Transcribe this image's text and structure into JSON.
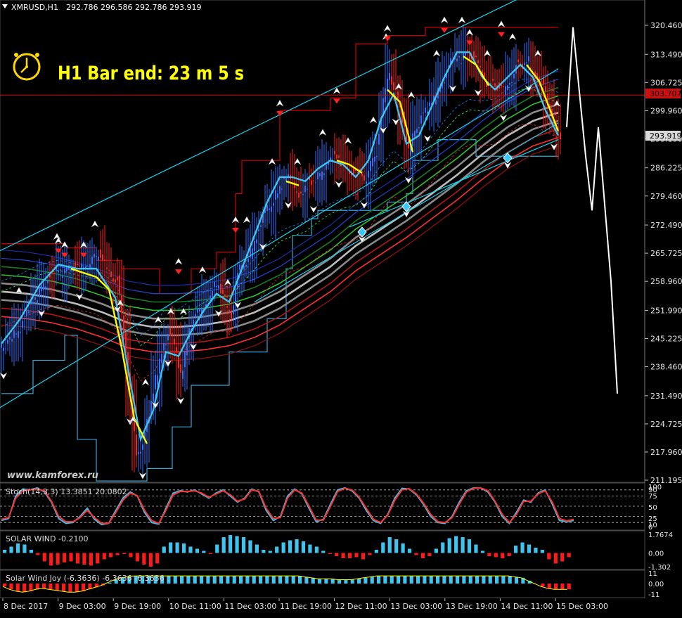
{
  "window": {
    "symbol_title": "XMRUSD,H1",
    "ohlc": "292.786 296.586 292.786 293.919"
  },
  "timer": {
    "text": "H1 Bar end: 23 m 5 s",
    "icon": "alarm-clock-icon",
    "color": "#ffff00"
  },
  "watermark": "www.kamforex.ru",
  "colors": {
    "bull": "#2a72ff",
    "bear": "#ff2020",
    "cyan": "#3fc3ef",
    "yellow": "#ffff00",
    "channel": "#17d4f0",
    "donchian_hi": "#d00000",
    "hline": "#d01010",
    "stoch_main": "#3fc3ef",
    "stoch_signal": "#ff3030",
    "forecast": "#ffffff"
  },
  "chart_data": [
    {
      "type": "line",
      "name": "main",
      "title": "XMRUSD,H1",
      "y_axis_ticks": [
        "320.460",
        "313.490",
        "306.725",
        "299.960",
        "293.190",
        "286.225",
        "279.460",
        "272.490",
        "265.725",
        "258.960",
        "251.990",
        "245.225",
        "238.460",
        "231.490",
        "224.725",
        "217.960",
        "211.195"
      ],
      "ylim": [
        211.195,
        320.46
      ],
      "x_axis_ticks": [
        "8 Dec 2017",
        "9 Dec 03:00",
        "9 Dec 19:00",
        "10 Dec 11:00",
        "11 Dec 03:00",
        "11 Dec 19:00",
        "12 Dec 11:00",
        "13 Dec 03:00",
        "13 Dec 19:00",
        "14 Dec 11:00",
        "15 Dec 03:00"
      ],
      "current_price": "293.919",
      "hline_price": "303.707",
      "close_path": [
        [
          0,
          243
        ],
        [
          3,
          249
        ],
        [
          6,
          258
        ],
        [
          9,
          262
        ],
        [
          12,
          262
        ],
        [
          15,
          265
        ],
        [
          18,
          259
        ],
        [
          19,
          246
        ],
        [
          20,
          232
        ],
        [
          21,
          218
        ],
        [
          22,
          219
        ],
        [
          23,
          227
        ],
        [
          24,
          236
        ],
        [
          25,
          242
        ],
        [
          26,
          246
        ],
        [
          27,
          244
        ],
        [
          28,
          237
        ],
        [
          29,
          244
        ],
        [
          30,
          250
        ],
        [
          32,
          254
        ],
        [
          34,
          258
        ],
        [
          36,
          251
        ],
        [
          37,
          260
        ],
        [
          39,
          266
        ],
        [
          41,
          274
        ],
        [
          43,
          280
        ],
        [
          45,
          284
        ],
        [
          47,
          280
        ],
        [
          49,
          283
        ],
        [
          51,
          287
        ],
        [
          53,
          289
        ],
        [
          55,
          285
        ],
        [
          57,
          284
        ],
        [
          59,
          290
        ],
        [
          60,
          302
        ],
        [
          61,
          310
        ],
        [
          62,
          304
        ],
        [
          63,
          298
        ],
        [
          64,
          290
        ],
        [
          65,
          296
        ],
        [
          67,
          300
        ],
        [
          69,
          306
        ],
        [
          71,
          312
        ],
        [
          73,
          314
        ],
        [
          75,
          311
        ],
        [
          77,
          306
        ],
        [
          79,
          305
        ],
        [
          81,
          310
        ],
        [
          83,
          312
        ],
        [
          85,
          306
        ],
        [
          87,
          298
        ],
        [
          88,
          293.9
        ]
      ],
      "cyan_ma": [
        [
          0,
          244
        ],
        [
          3,
          250
        ],
        [
          6,
          258
        ],
        [
          9,
          263
        ],
        [
          12,
          262
        ],
        [
          15,
          262
        ],
        [
          18,
          255
        ],
        [
          20,
          238
        ],
        [
          22,
          221
        ],
        [
          24,
          228
        ],
        [
          26,
          242
        ],
        [
          28,
          241
        ],
        [
          30,
          247
        ],
        [
          32,
          252
        ],
        [
          34,
          256
        ],
        [
          36,
          254
        ],
        [
          38,
          262
        ],
        [
          40,
          270
        ],
        [
          42,
          278
        ],
        [
          44,
          284
        ],
        [
          46,
          284
        ],
        [
          48,
          283
        ],
        [
          50,
          286
        ],
        [
          52,
          288
        ],
        [
          54,
          287
        ],
        [
          56,
          284
        ],
        [
          58,
          288
        ],
        [
          60,
          298
        ],
        [
          62,
          304
        ],
        [
          64,
          292
        ],
        [
          66,
          294
        ],
        [
          68,
          301
        ],
        [
          70,
          308
        ],
        [
          72,
          314
        ],
        [
          74,
          314
        ],
        [
          76,
          308
        ],
        [
          78,
          305
        ],
        [
          80,
          308
        ],
        [
          82,
          311
        ],
        [
          84,
          308
        ],
        [
          86,
          300
        ],
        [
          88,
          294
        ]
      ],
      "yellow_ma": [
        [
          11,
          262
        ],
        [
          13,
          261
        ],
        [
          15,
          260
        ],
        [
          17,
          257
        ],
        [
          19,
          243
        ],
        [
          21,
          226
        ],
        [
          23,
          220
        ],
        [
          25,
          226
        ],
        [
          27,
          238
        ],
        [
          29,
          245
        ],
        [
          31,
          249
        ],
        [
          33,
          253
        ],
        [
          35,
          256
        ],
        [
          37,
          259
        ],
        [
          39,
          264
        ],
        [
          41,
          271
        ],
        [
          43,
          278
        ],
        [
          45,
          283
        ],
        [
          47,
          282
        ],
        [
          49,
          283
        ],
        [
          51,
          286
        ],
        [
          53,
          288
        ],
        [
          55,
          287
        ],
        [
          57,
          285
        ],
        [
          59,
          292
        ],
        [
          61,
          305
        ],
        [
          63,
          302
        ],
        [
          65,
          290
        ],
        [
          67,
          298
        ],
        [
          69,
          304
        ],
        [
          71,
          310
        ],
        [
          73,
          313
        ],
        [
          75,
          311
        ],
        [
          77,
          306
        ],
        [
          79,
          306
        ],
        [
          81,
          309
        ],
        [
          83,
          311
        ],
        [
          85,
          307
        ],
        [
          87,
          299
        ],
        [
          88,
          295
        ]
      ],
      "ma_band": [
        [
          0,
          257
        ],
        [
          4,
          256.5
        ],
        [
          8,
          255.5
        ],
        [
          12,
          254
        ],
        [
          16,
          252
        ],
        [
          20,
          249.5
        ],
        [
          24,
          248.5
        ],
        [
          28,
          248.5
        ],
        [
          32,
          249
        ],
        [
          36,
          250
        ],
        [
          40,
          252
        ],
        [
          44,
          255
        ],
        [
          48,
          259
        ],
        [
          52,
          263
        ],
        [
          56,
          268
        ],
        [
          60,
          272
        ],
        [
          64,
          276
        ],
        [
          68,
          280.5
        ],
        [
          72,
          285
        ],
        [
          76,
          290
        ],
        [
          80,
          294.5
        ],
        [
          84,
          298
        ],
        [
          88,
          300
        ]
      ],
      "donchian_upper": [
        [
          0,
          268
        ],
        [
          8,
          268
        ],
        [
          10,
          267
        ],
        [
          14,
          267
        ],
        [
          15,
          264
        ],
        [
          18,
          264
        ],
        [
          19,
          262
        ],
        [
          24,
          262
        ],
        [
          25,
          256
        ],
        [
          29,
          256
        ],
        [
          30,
          262
        ],
        [
          33,
          262
        ],
        [
          34,
          266
        ],
        [
          36,
          266
        ],
        [
          37,
          280
        ],
        [
          38,
          288
        ],
        [
          43,
          288
        ],
        [
          44,
          300
        ],
        [
          51,
          300
        ],
        [
          52,
          303
        ],
        [
          55,
          303
        ],
        [
          56,
          316
        ],
        [
          60,
          316
        ],
        [
          61,
          318
        ],
        [
          66,
          318
        ],
        [
          67,
          320
        ],
        [
          88,
          320
        ]
      ],
      "donchian_lower": [
        [
          0,
          232
        ],
        [
          4,
          232
        ],
        [
          5,
          240
        ],
        [
          9,
          240
        ],
        [
          10,
          246
        ],
        [
          11,
          246
        ],
        [
          12,
          221
        ],
        [
          14,
          221
        ],
        [
          15,
          211
        ],
        [
          22,
          211
        ],
        [
          23,
          214
        ],
        [
          26,
          214
        ],
        [
          27,
          224
        ],
        [
          29,
          224
        ],
        [
          30,
          234
        ],
        [
          35,
          234
        ],
        [
          36,
          242
        ],
        [
          41,
          242
        ],
        [
          42,
          250
        ],
        [
          45,
          262
        ],
        [
          46,
          270
        ],
        [
          49,
          274
        ],
        [
          50,
          276
        ],
        [
          60,
          276
        ],
        [
          61,
          278
        ],
        [
          64,
          280
        ],
        [
          65,
          288
        ],
        [
          69,
          293
        ],
        [
          70,
          293
        ],
        [
          74,
          293
        ],
        [
          75,
          289
        ],
        [
          80,
          289
        ],
        [
          88,
          289
        ]
      ],
      "channel_lines": [
        {
          "from": [
            -2,
            265
          ],
          "to": [
            86,
            330
          ]
        },
        {
          "from": [
            -2,
            227
          ],
          "to": [
            88,
            310
          ]
        },
        {
          "from": [
            40,
            254
          ],
          "to": [
            88,
            297
          ]
        },
        {
          "from": [
            55,
            272
          ],
          "to": [
            88,
            293
          ]
        }
      ],
      "hline_values": [
        303.707
      ],
      "fractal_up_markers": [
        [
          9,
          267
        ],
        [
          10,
          266
        ],
        [
          13,
          266
        ],
        [
          28,
          262
        ],
        [
          37,
          272
        ],
        [
          44,
          300
        ],
        [
          53,
          303
        ],
        [
          61,
          318
        ],
        [
          70,
          320
        ],
        [
          74,
          317
        ],
        [
          79,
          319
        ]
      ],
      "fractal_down_markers": [
        [
          57,
          270.8
        ],
        [
          64,
          276.9
        ],
        [
          80,
          288.6
        ]
      ],
      "forecast_path": [
        [
          88,
          296
        ],
        [
          89,
          320
        ],
        [
          91,
          289
        ],
        [
          92,
          276
        ],
        [
          93,
          296
        ],
        [
          95,
          259
        ],
        [
          96,
          232
        ]
      ]
    },
    {
      "type": "line",
      "name": "stochastic",
      "title": "Stoch(14,3,3) 13.3851 20.0802",
      "y_axis_ticks": [
        "100",
        "90",
        "75",
        "50",
        "25",
        "10",
        "0"
      ],
      "ylim": [
        0,
        100
      ],
      "series": [
        {
          "name": "Stoch",
          "values": [
            15,
            20,
            75,
            92,
            90,
            95,
            85,
            60,
            20,
            8,
            10,
            25,
            45,
            18,
            5,
            8,
            40,
            70,
            85,
            75,
            35,
            10,
            6,
            45,
            82,
            88,
            85,
            90,
            80,
            70,
            82,
            90,
            75,
            60,
            70,
            92,
            85,
            40,
            15,
            25,
            75,
            92,
            80,
            45,
            12,
            18,
            55,
            90,
            95,
            88,
            70,
            40,
            15,
            8,
            30,
            70,
            94,
            92,
            78,
            55,
            25,
            10,
            8,
            25,
            60,
            88,
            95,
            95,
            85,
            60,
            25,
            8,
            35,
            65,
            60,
            82,
            90,
            55,
            15,
            12,
            15
          ]
        },
        {
          "name": "Signal",
          "values": [
            18,
            22,
            70,
            88,
            90,
            92,
            88,
            62,
            25,
            12,
            12,
            22,
            40,
            22,
            8,
            8,
            35,
            65,
            82,
            76,
            40,
            15,
            8,
            40,
            78,
            86,
            86,
            88,
            82,
            72,
            80,
            88,
            78,
            62,
            68,
            90,
            86,
            45,
            20,
            22,
            70,
            90,
            82,
            50,
            16,
            16,
            50,
            86,
            94,
            90,
            72,
            45,
            18,
            10,
            28,
            65,
            90,
            93,
            80,
            58,
            30,
            12,
            10,
            22,
            55,
            85,
            94,
            95,
            88,
            62,
            30,
            10,
            30,
            62,
            62,
            80,
            88,
            60,
            20,
            14,
            18
          ]
        }
      ]
    },
    {
      "type": "bar",
      "name": "solar-wind",
      "title": "SOLAR WIND -0.2100",
      "y_axis_ticks": [
        "1.7674",
        "0.00",
        "-1.302"
      ],
      "ylim": [
        -1.302,
        1.7674
      ],
      "values": [
        0.3,
        0.6,
        0.9,
        0.8,
        0.3,
        -0.2,
        -0.8,
        -1.2,
        -1.1,
        -0.9,
        -0.8,
        -1.0,
        -1.1,
        -1.2,
        -1.0,
        -0.6,
        -0.4,
        -0.2,
        -0.1,
        -0.4,
        -0.8,
        -1.1,
        -1.3,
        -1.0,
        0.6,
        1.0,
        1.0,
        0.9,
        0.6,
        0.4,
        0.2,
        -0.1,
        0.8,
        1.5,
        1.7,
        1.6,
        1.5,
        1.2,
        0.8,
        0.3,
        0.2,
        0.6,
        1.0,
        1.2,
        1.3,
        1.1,
        0.8,
        0.6,
        0.2,
        -0.1,
        -0.3,
        -0.5,
        -0.5,
        -0.4,
        -0.6,
        -0.2,
        0.3,
        1.0,
        1.5,
        1.3,
        0.9,
        0.4,
        -0.2,
        -0.5,
        -0.3,
        0.4,
        1.0,
        1.4,
        1.6,
        1.5,
        1.3,
        0.8,
        0.2,
        -0.3,
        -0.4,
        -0.5,
        -0.3,
        0.7,
        1.0,
        0.8,
        0.5,
        0.3,
        -0.6,
        -1.0,
        -0.8,
        -0.4
      ]
    },
    {
      "type": "area",
      "name": "solar-wind-joy",
      "title": "Solar Wind Joy (-6.3636) -6.3636 -6.3636",
      "y_axis_ticks": [
        "11",
        "0.00",
        "-11"
      ],
      "ylim": [
        -11,
        11
      ],
      "values": [
        -3,
        -6,
        -8,
        -9,
        -8,
        -6,
        -5,
        -6,
        -7,
        -8,
        -9,
        -9,
        -8,
        -6,
        -4,
        -2,
        1,
        4,
        6,
        7,
        8,
        8,
        8,
        8,
        8,
        8,
        8,
        8,
        8,
        8,
        8,
        8,
        8,
        8,
        8,
        8,
        8,
        8,
        8,
        8,
        8,
        8,
        8,
        8,
        8,
        8,
        7,
        6,
        5,
        5,
        5,
        4,
        4,
        4,
        5,
        6,
        7,
        8,
        8,
        8,
        8,
        8,
        8,
        8,
        8,
        8,
        8,
        8,
        8,
        8,
        8,
        8,
        8,
        8,
        8,
        8,
        8,
        8,
        7,
        6,
        3,
        0,
        -3,
        -5,
        -6,
        -6,
        -6
      ]
    }
  ]
}
